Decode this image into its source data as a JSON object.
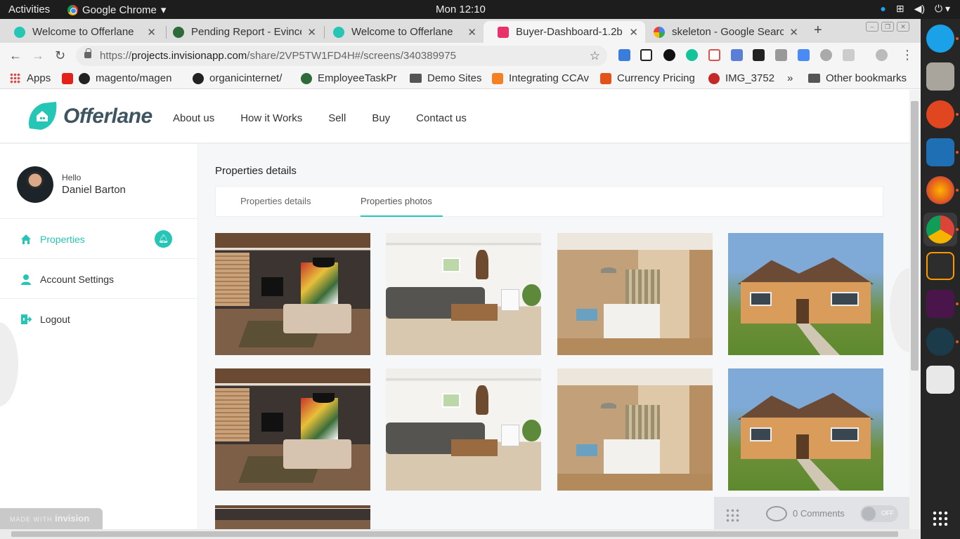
{
  "system": {
    "activities": "Activities",
    "app_name": "Google Chrome",
    "clock": "Mon 12:10"
  },
  "tabs": [
    {
      "label": "Welcome to Offerlane",
      "color": "#26c6b6"
    },
    {
      "label": "Pending Report - Evince",
      "color": "#2f6b3a"
    },
    {
      "label": "Welcome to Offerlane",
      "color": "#26c6b6"
    },
    {
      "label": "Buyer-Dashboard-1.2b",
      "color": "#e8336a"
    },
    {
      "label": "skeleton - Google Search",
      "color": "#4285f4"
    }
  ],
  "browser": {
    "url_prefix": "https://",
    "url_domain": "projects.invisionapp.com",
    "url_path": "/share/2VP5TW1FD4H#/screens/340389975"
  },
  "bookmarks": [
    {
      "label": "Apps",
      "icon": "apps-icon"
    },
    {
      "label": "magento/magen",
      "icon": "magento-icon"
    },
    {
      "label": "organicinternet/",
      "icon": "github-icon"
    },
    {
      "label": "EmployeeTaskPr",
      "icon": "evince-icon"
    },
    {
      "label": "Demo Sites",
      "icon": "folder-icon"
    },
    {
      "label": "Integrating CCAv",
      "icon": "stack-icon"
    },
    {
      "label": "Currency Pricing",
      "icon": "magento-icon"
    },
    {
      "label": "IMG_3752",
      "icon": "image-icon"
    },
    {
      "label": "»",
      "icon": "chevron-icon"
    },
    {
      "label": "Other bookmarks",
      "icon": "folder-icon"
    }
  ],
  "site": {
    "logo_text": "Offerlane",
    "brand_color": "#26c6b6",
    "nav": [
      "About us",
      "How it Works",
      "Sell",
      "Buy",
      "Contact us"
    ]
  },
  "sidebar": {
    "greeting": "Hello",
    "user_name": "Daniel Barton",
    "items": [
      {
        "label": "Properties",
        "icon": "home-icon",
        "active": true
      },
      {
        "label": "Account Settings",
        "icon": "user-icon",
        "active": false
      },
      {
        "label": "Logout",
        "icon": "logout-icon",
        "active": false
      }
    ]
  },
  "main": {
    "title": "Properties details",
    "tabs": [
      "Properties details",
      "Properties photos"
    ],
    "active_tab": "Properties photos",
    "photos": [
      "living-room",
      "white-living-room",
      "bedroom",
      "brick-house",
      "living-room",
      "white-living-room",
      "bedroom",
      "brick-house",
      "living-room"
    ]
  },
  "invision": {
    "made_with": "MADE WITH",
    "brand": "invision",
    "comments": "0 Comments",
    "toggle": "OFF"
  }
}
